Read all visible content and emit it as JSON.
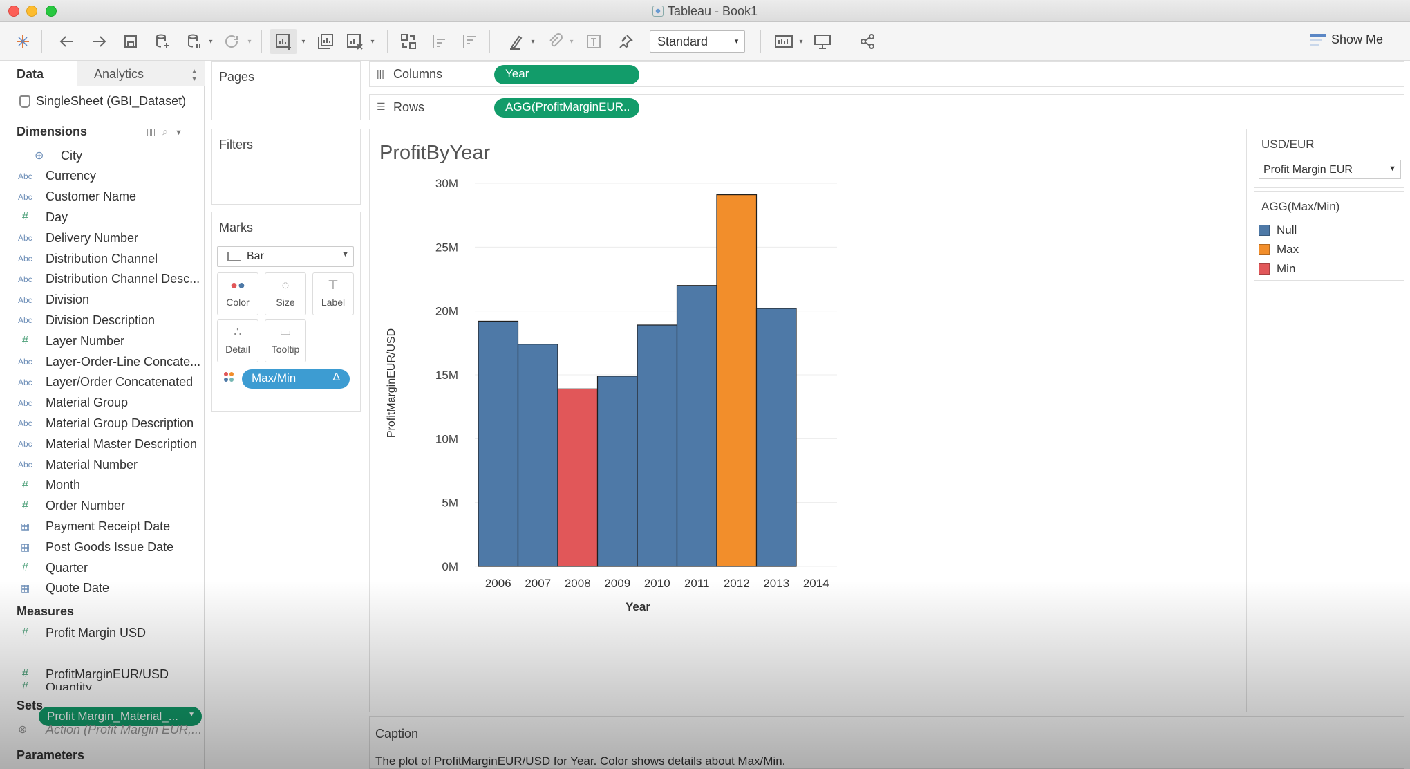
{
  "window": {
    "title": "Tableau - Book1"
  },
  "toolbar": {
    "fit_select": "Standard",
    "show_me": "Show Me"
  },
  "data_pane": {
    "tabs": [
      "Data",
      "Analytics"
    ],
    "datasource": "SingleSheet (GBI_Dataset)",
    "dimensions_header": "Dimensions",
    "dimensions": [
      {
        "type": "globe",
        "label": "City"
      },
      {
        "type": "Abc",
        "label": "Currency"
      },
      {
        "type": "Abc",
        "label": "Customer Name"
      },
      {
        "type": "#",
        "label": "Day"
      },
      {
        "type": "Abc",
        "label": "Delivery Number"
      },
      {
        "type": "Abc",
        "label": "Distribution Channel"
      },
      {
        "type": "Abc",
        "label": "Distribution Channel Desc..."
      },
      {
        "type": "Abc",
        "label": "Division"
      },
      {
        "type": "Abc",
        "label": "Division Description"
      },
      {
        "type": "#",
        "label": "Layer Number"
      },
      {
        "type": "Abc",
        "label": "Layer-Order-Line Concate..."
      },
      {
        "type": "Abc",
        "label": "Layer/Order Concatenated"
      },
      {
        "type": "Abc",
        "label": "Material Group"
      },
      {
        "type": "Abc",
        "label": "Material Group Description"
      },
      {
        "type": "Abc",
        "label": "Material Master Description"
      },
      {
        "type": "Abc",
        "label": "Material Number"
      },
      {
        "type": "#",
        "label": "Month"
      },
      {
        "type": "#",
        "label": "Order Number"
      },
      {
        "type": "cal",
        "label": "Payment Receipt Date"
      },
      {
        "type": "cal",
        "label": "Post Goods Issue Date"
      },
      {
        "type": "#",
        "label": "Quarter"
      },
      {
        "type": "cal",
        "label": "Quote Date"
      }
    ],
    "measures_header": "Measures",
    "measures": [
      "Profit Margin USD",
      "Profit Margin_Material_...",
      "ProfitMarginEUR/USD",
      "Quantity"
    ],
    "sets_header": "Sets",
    "sets_item": "Action (Profit Margin EUR,...",
    "parameters_header": "Parameters"
  },
  "cards": {
    "pages": "Pages",
    "filters": "Filters",
    "marks": "Marks",
    "mark_type": "Bar",
    "mark_buttons": [
      "Color",
      "Size",
      "Label",
      "Detail",
      "Tooltip"
    ],
    "marks_pill": "Max/Min",
    "marks_pill_icon": "Δ"
  },
  "shelves": {
    "columns_label": "Columns",
    "columns_pill": "Year",
    "rows_label": "Rows",
    "rows_pill": "AGG(ProfitMarginEUR.."
  },
  "viz": {
    "title": "ProfitByYear"
  },
  "right_panel": {
    "param_title": "USD/EUR",
    "param_value": "Profit Margin EUR",
    "legend_title": "AGG(Max/Min)",
    "legend": [
      {
        "label": "Null",
        "color": "#4e79a7"
      },
      {
        "label": "Max",
        "color": "#f28e2b"
      },
      {
        "label": "Min",
        "color": "#e15759"
      }
    ]
  },
  "caption": {
    "title": "Caption",
    "text": "The plot of ProfitMarginEUR/USD for Year.  Color shows details about Max/Min."
  },
  "chart_data": {
    "type": "bar",
    "title": "",
    "xlabel": "Year",
    "ylabel": "ProfitMarginEUR/USD",
    "categories": [
      "2006",
      "2007",
      "2008",
      "2009",
      "2010",
      "2011",
      "2012",
      "2013",
      "2014"
    ],
    "values": [
      19.2,
      17.4,
      13.9,
      14.9,
      18.9,
      22.0,
      29.1,
      20.2,
      null
    ],
    "value_unit": "M",
    "color_group": [
      "Null",
      "Null",
      "Min",
      "Null",
      "Null",
      "Null",
      "Max",
      "Null",
      null
    ],
    "colors": {
      "Null": "#4e79a7",
      "Max": "#f28e2b",
      "Min": "#e15759"
    },
    "ylim": [
      0,
      30
    ],
    "yticks": [
      "0M",
      "5M",
      "10M",
      "15M",
      "20M",
      "25M",
      "30M"
    ],
    "grid": true
  }
}
